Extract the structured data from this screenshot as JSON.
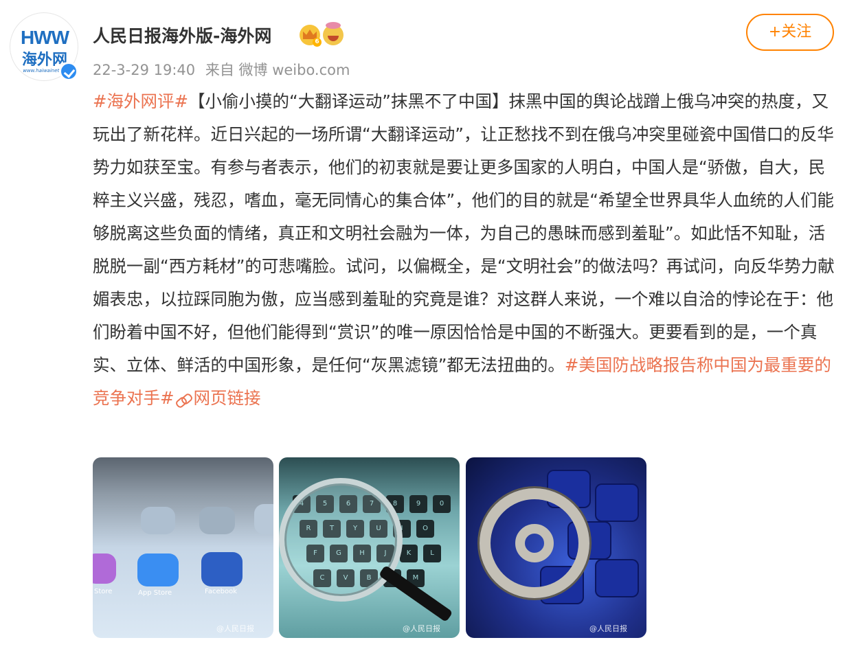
{
  "avatar": {
    "logo_text_h": "HWW",
    "logo_cn": "海外网",
    "logo_url": "www.haiwainet.cn"
  },
  "author": {
    "name": "人民日报海外版-海外网",
    "badges": [
      "crown-badge-icon",
      "face-badge-icon"
    ]
  },
  "meta": {
    "time": "22-3-29 19:40",
    "source": "来自 微博 weibo.com"
  },
  "follow": {
    "label": "+关注"
  },
  "post": {
    "tag_start": "#海外网评#",
    "text": "【小偷小摸的“大翻译运动”抹黑不了中国】抹黑中国的舆论战蹭上俄乌冲突的热度，又玩出了新花样。近日兴起的一场所谓“大翻译运动”，让正愁找不到在俄乌冲突里碰瓷中国借口的反华势力如获至宝。有参与者表示，他们的初衷就是要让更多国家的人明白，中国人是“骄傲，自大，民粹主义兴盛，残忍，嗜血，毫无同情心的集合体”，他们的目的就是“希望全世界具华人血统的人们能够脱离这些负面的情绪，真正和文明社会融为一体，为自己的愚昧而感到羞耻”。如此恬不知耻，活脱脱一副“西方耗材”的可悲嘴脸。试问，以偏概全，是“文明社会”的做法吗？再试问，向反华势力献媚表忠，以拉踩同胞为傲，应当感到羞耻的究竟是谁？对这群人来说，一个难以自洽的悖论在于：他们盼着中国不好，但他们能得到“赏识”的唯一原因恰恰是中国的不断强大。更要看到的是，一个真实、立体、鲜活的中国形象，是任何“灰黑滤镜”都无法扭曲的。",
    "tag_end": "#美国防战略报告称中国为最重要的竞争对手#",
    "link_label": "网页链接"
  },
  "images": [
    {
      "watermark": "@人民日报",
      "apps": [
        {
          "label": "Store",
          "color": "#b06ad8"
        },
        {
          "label": "App Store",
          "color": "#3a8ef2"
        },
        {
          "label": "Facebook",
          "color": "#2d5fc4"
        }
      ]
    },
    {
      "watermark": "@人民日报",
      "keys": [
        "4",
        "5",
        "6",
        "7",
        "8",
        "9",
        "0",
        "R",
        "T",
        "Y",
        "U",
        "I",
        "O",
        "F",
        "G",
        "H",
        "J",
        "K",
        "L",
        "C",
        "V",
        "B",
        "N",
        "M"
      ]
    },
    {
      "watermark": "@人民日报"
    }
  ]
}
